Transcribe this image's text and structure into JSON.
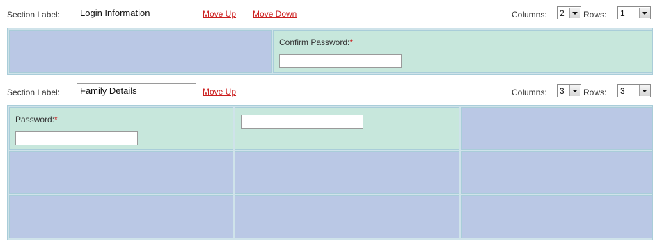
{
  "sections": [
    {
      "label_text": "Section Label:",
      "name_value": "Login Information",
      "move_up": "Move Up",
      "move_down": "Move Down",
      "columns_label": "Columns:",
      "columns_value": "2",
      "rows_label": "Rows:",
      "rows_value": "1",
      "fields": [
        {
          "label": "Confirm Password:",
          "required_mark": "*"
        }
      ]
    },
    {
      "label_text": "Section Label:",
      "name_value": "Family Details",
      "move_up": "Move Up",
      "columns_label": "Columns:",
      "columns_value": "3",
      "rows_label": "Rows:",
      "rows_value": "3",
      "fields": [
        {
          "label": "Password:",
          "required_mark": "*"
        }
      ]
    }
  ]
}
